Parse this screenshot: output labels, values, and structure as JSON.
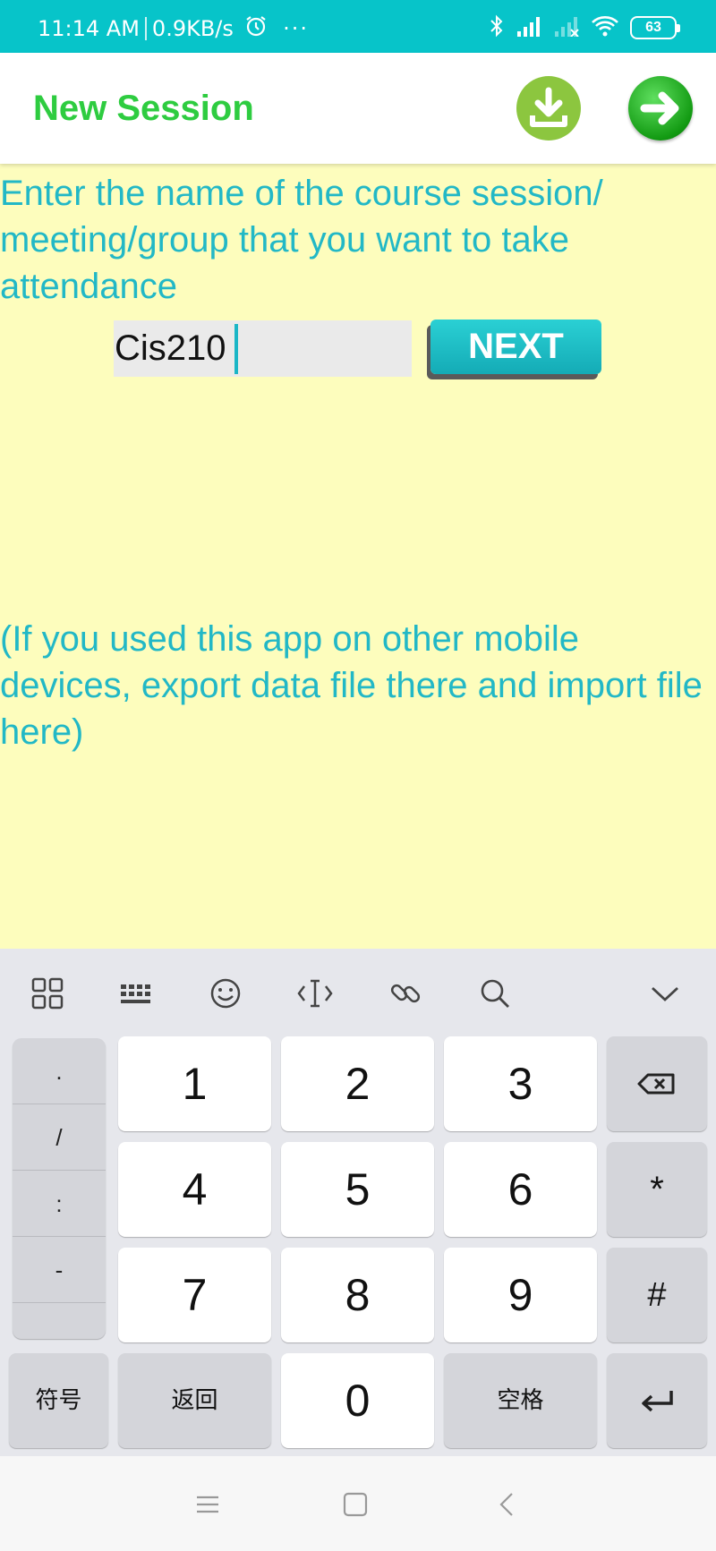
{
  "status_bar": {
    "time": "11:14 AM",
    "speed": "0.9KB/s",
    "more": "···",
    "battery": "63",
    "icons": [
      "alarm-icon",
      "bluetooth-icon",
      "signal-icon",
      "signal-no-service-icon",
      "wifi-icon",
      "battery-icon"
    ]
  },
  "app_bar": {
    "title": "New Session",
    "import_icon": "download-icon",
    "next_icon": "arrow-right-icon",
    "colors": {
      "title": "#2ecc40",
      "import": "#8cc63f",
      "next": "#139b13"
    }
  },
  "content": {
    "prompt": "Enter the name of the course session/ meeting/group that you want to take attendance",
    "session_name": "Cis210",
    "next_label": "NEXT",
    "hint": "(If you used this app on other mobile devices, export data file there and import file here)",
    "colors": {
      "background": "#fdfdbd",
      "text": "#22b8c6",
      "button": "#1bb6c6"
    }
  },
  "keyboard": {
    "toolbar": [
      "apps-grid-icon",
      "keyboard-icon",
      "emoji-icon",
      "cursor-icon",
      "link-icon",
      "search-icon",
      "chevron-down-icon"
    ],
    "side_keys": [
      ".",
      "/",
      ":",
      "-"
    ],
    "digits": [
      "1",
      "2",
      "3",
      "4",
      "5",
      "6",
      "7",
      "8",
      "9",
      "0"
    ],
    "backspace_icon": "backspace-icon",
    "star": "*",
    "hash": "#",
    "symbols": "符号",
    "back": "返回",
    "space": "空格",
    "enter_icon": "enter-icon"
  },
  "nav_bar": {
    "icons": [
      "menu-icon",
      "home-icon",
      "back-icon"
    ]
  }
}
